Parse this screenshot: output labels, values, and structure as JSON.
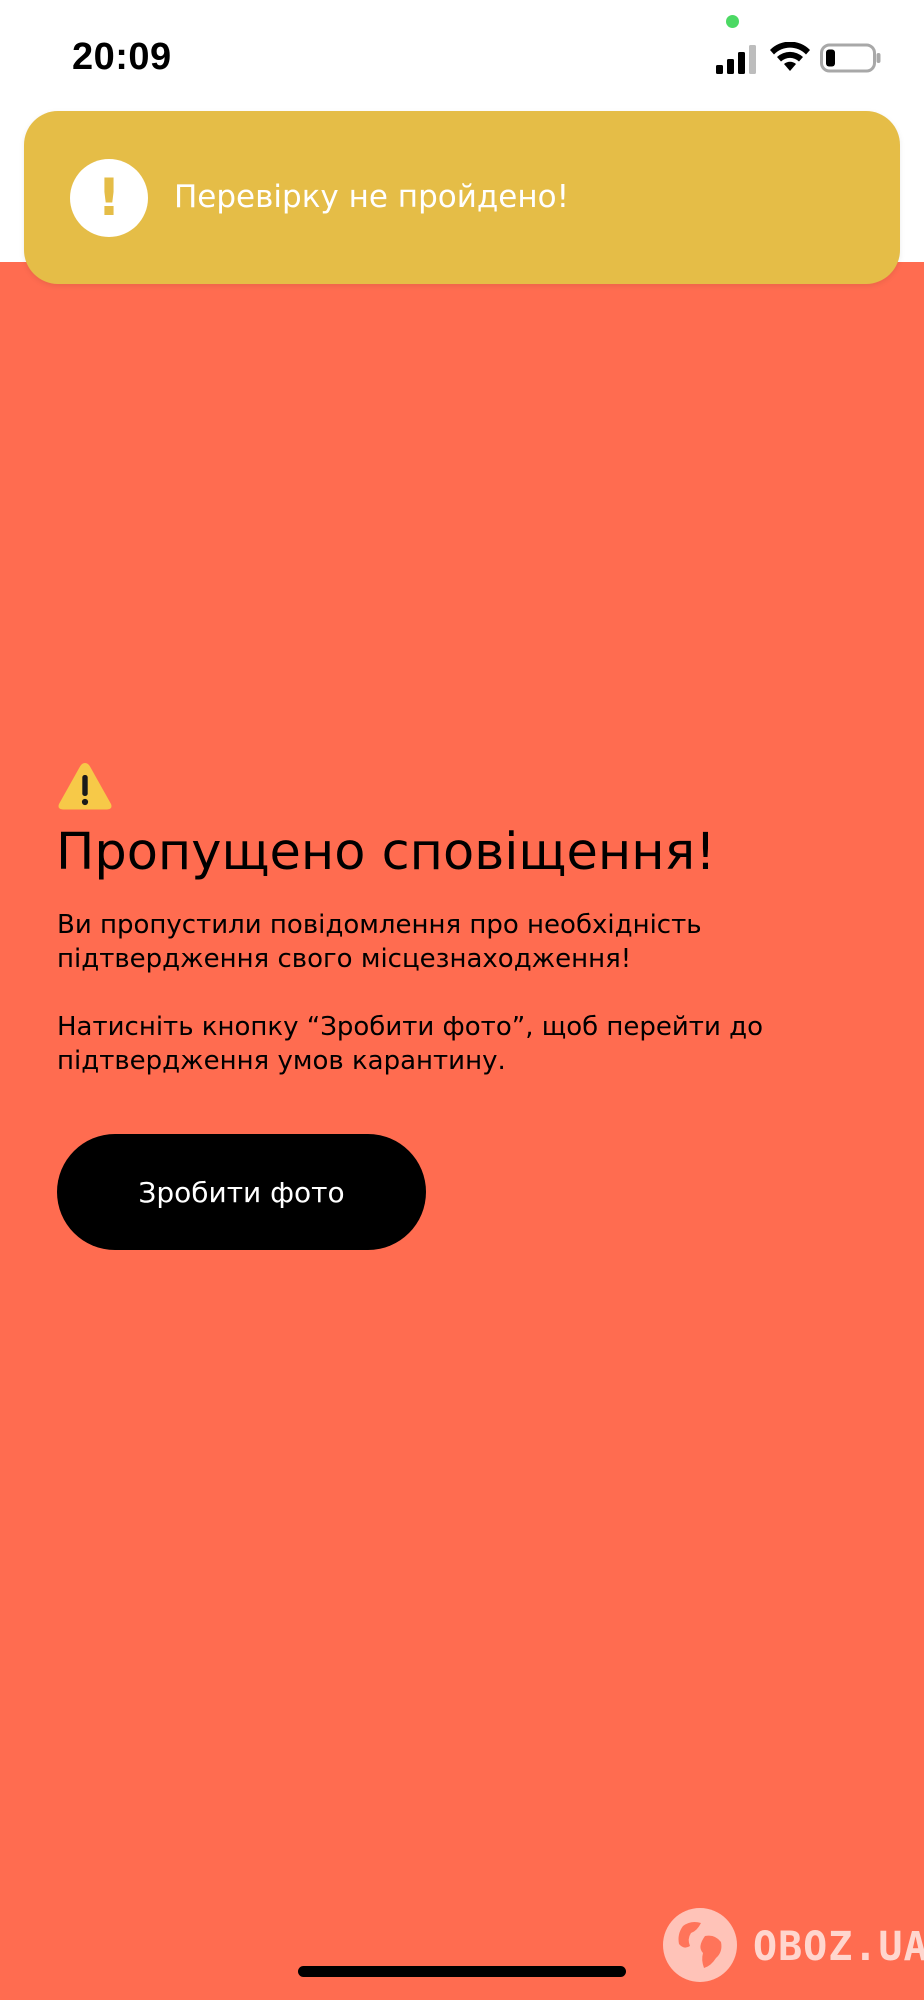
{
  "status_bar": {
    "time": "20:09",
    "icons": [
      "privacy-dot",
      "cellular-signal-icon",
      "wifi-icon",
      "battery-icon"
    ],
    "privacy_dot_color": "#4cd964",
    "battery_level": 0.2
  },
  "banner": {
    "icon": "exclamation-circle-icon",
    "icon_glyph": "!",
    "text": "Перевірку не пройдено!",
    "background_color": "#e5bd47"
  },
  "main": {
    "warning_icon": "warning-triangle-icon",
    "title": "Пропущено сповіщення!",
    "paragraph_1": "Ви пропустили повідомлення про необхідність підтвердження свого місцезнаходження!",
    "paragraph_2": "Натисніть кнопку “Зробити фото”, щоб перейти до підтвердження умов карантину.",
    "button_label": "Зробити фото",
    "background_color": "#ff6c50"
  },
  "watermark": {
    "text": "OBOZ.UA",
    "icon": "globe-icon"
  }
}
